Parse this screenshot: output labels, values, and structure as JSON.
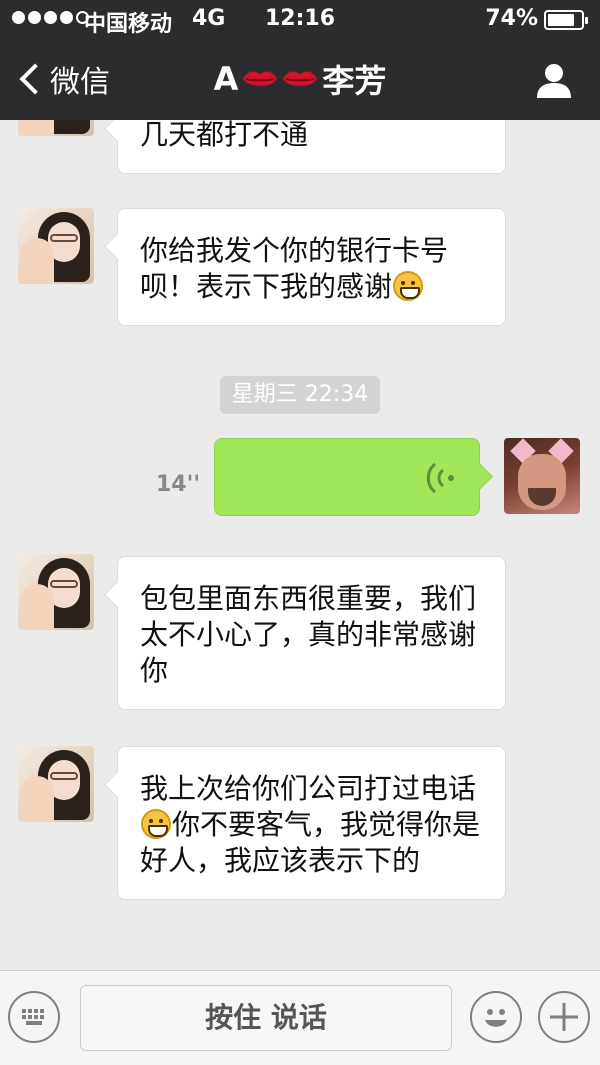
{
  "status_bar": {
    "carrier": "中国移动",
    "network": "4G",
    "time": "12:16",
    "battery": "74%",
    "battery_level": 0.74
  },
  "nav": {
    "back_label": "微信",
    "title_prefix": "A",
    "title_name": "李芳"
  },
  "messages": [
    {
      "from": "contact",
      "text": "几天都打不通"
    },
    {
      "from": "contact",
      "text_before": "你给我发个你的银行卡号呗！表示下我的感谢",
      "text_after": ""
    },
    {
      "timestamp": "星期三 22:34"
    },
    {
      "from": "me",
      "type": "voice",
      "duration": "14''"
    },
    {
      "from": "contact",
      "text": "包包里面东西很重要，我们太不小心了，真的非常感谢你"
    },
    {
      "from": "contact",
      "text_before": "我上次给你们公司打过电话",
      "text_after": "你不要客气，我觉得你是好人，我应该表示下的"
    }
  ],
  "input_bar": {
    "talk_label": "按住 说话"
  },
  "colors": {
    "nav_bg": "#2c2c2e",
    "chat_bg": "#ebebeb",
    "voice_bubble": "#a0e75a"
  },
  "icons": {
    "back": "chevron-left-icon",
    "profile": "person-icon",
    "keyboard": "keyboard-icon",
    "emoji": "smiley-icon",
    "plus": "plus-icon",
    "voice": "sound-wave-icon",
    "lips": "lips-emoji-icon"
  }
}
